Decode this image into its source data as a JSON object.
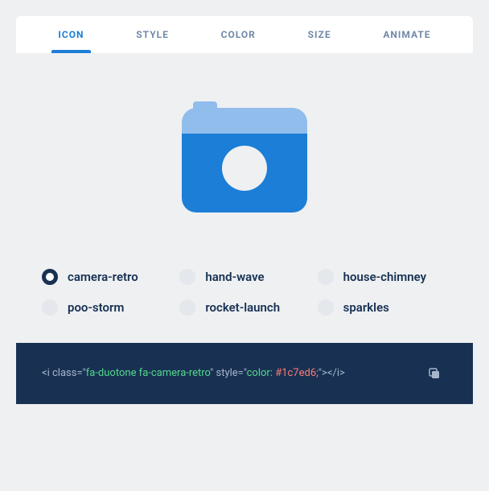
{
  "tabs": {
    "icon": "ICON",
    "style": "STYLE",
    "color": "COLOR",
    "size": "SIZE",
    "animate": "ANIMATE"
  },
  "options": {
    "camera_retro": "camera-retro",
    "hand_wave": "hand-wave",
    "house_chimney": "house-chimney",
    "poo_storm": "poo-storm",
    "rocket_launch": "rocket-launch",
    "sparkles": "sparkles"
  },
  "selected_option": "camera-retro",
  "code": {
    "open1": "<i class=\"",
    "class_value": "fa-duotone fa-camera-retro",
    "mid": "\" style=\"",
    "style_prop": "color: ",
    "style_hex": "#1c7ed6;",
    "close": "\"></i>"
  }
}
